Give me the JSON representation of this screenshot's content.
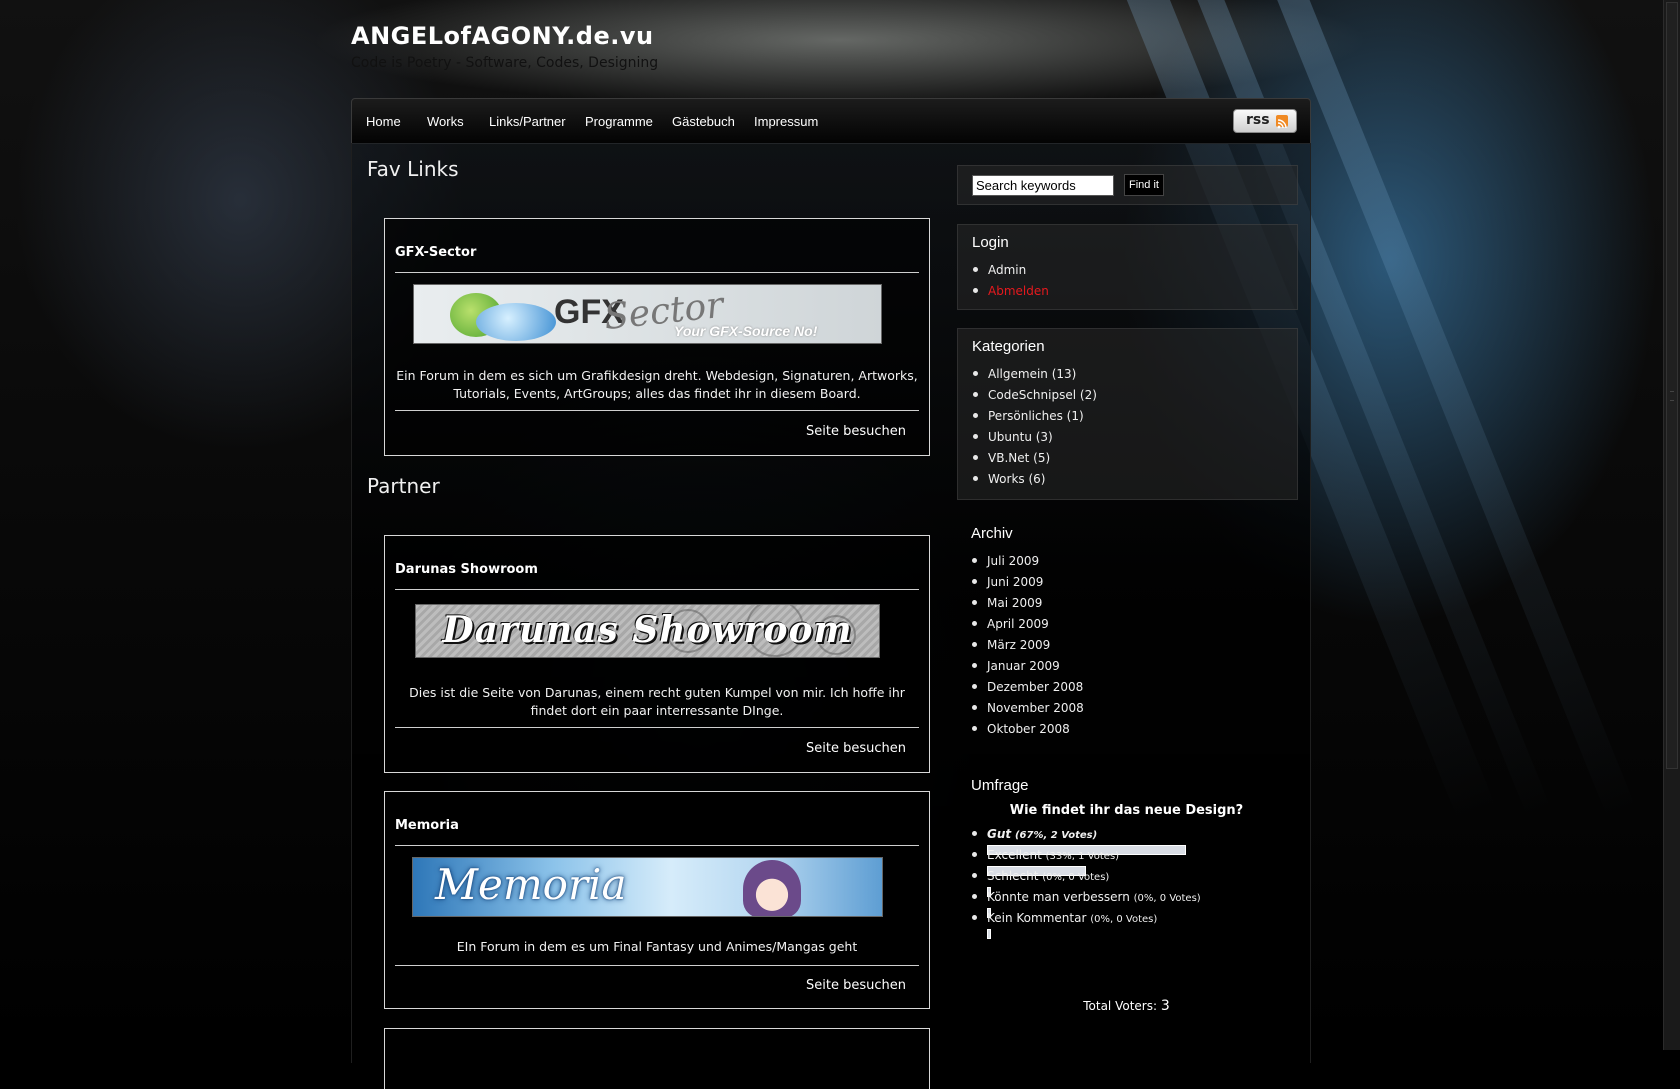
{
  "site": {
    "title": "ANGELofAGONY.de.vu",
    "tagline": "Code is Poetry - Software, Codes, Designing"
  },
  "nav": {
    "items": [
      "Home",
      "Works",
      "Links/Partner",
      "Programme",
      "Gästebuch",
      "Impressum"
    ],
    "rss_label": "rss"
  },
  "main": {
    "fav_title": "Fav Links",
    "partner_title": "Partner",
    "cards": [
      {
        "title": "GFX-Sector",
        "banner_text": "GFX",
        "banner_text2": "Sector",
        "banner_slogan": "Your GFX-Source No!",
        "description": "Ein Forum in dem es sich um Grafikdesign dreht. Webdesign, Signaturen, Artworks, Tutorials, Events, ArtGroups; alles das findet ihr in diesem Board.",
        "link": "Seite besuchen"
      },
      {
        "title": "Darunas Showroom",
        "banner_text": "Darunas Showroom",
        "description": "Dies ist die Seite von Darunas, einem recht guten Kumpel von mir. Ich hoffe ihr findet dort ein paar interressante DInge.",
        "link": "Seite besuchen"
      },
      {
        "title": "Memoria",
        "banner_text": "Memoria",
        "description": "EIn Forum in dem es um Final Fantasy und Animes/Mangas geht",
        "link": "Seite besuchen"
      }
    ]
  },
  "sidebar": {
    "search": {
      "placeholder": "Search keywords",
      "button": "Find it"
    },
    "login": {
      "title": "Login",
      "items": [
        "Admin",
        "Abmelden"
      ]
    },
    "categories": {
      "title": "Kategorien",
      "items": [
        "Allgemein (13)",
        "CodeSchnipsel (2)",
        "Persönliches (1)",
        "Ubuntu (3)",
        "VB.Net (5)",
        "Works (6)"
      ]
    },
    "archive": {
      "title": "Archiv",
      "items": [
        "Juli 2009",
        "Juni 2009",
        "Mai 2009",
        "April 2009",
        "März 2009",
        "Januar 2009",
        "Dezember 2008",
        "November 2008",
        "Oktober 2008"
      ]
    },
    "poll": {
      "title": "Umfrage",
      "question": "Wie findet ihr das neue Design?",
      "options": [
        {
          "label": "Gut",
          "stats": "(67%, 2 Votes)",
          "percent": 67
        },
        {
          "label": "Excellent",
          "stats": "(33%, 1 Votes)",
          "percent": 33
        },
        {
          "label": "Schlecht",
          "stats": "(0%, 0 Votes)",
          "percent": 0
        },
        {
          "label": "Könnte man verbessern",
          "stats": "(0%, 0 Votes)",
          "percent": 0
        },
        {
          "label": "Kein Kommentar",
          "stats": "(0%, 0 Votes)",
          "percent": 0
        }
      ],
      "total_label": "Total Voters:",
      "total_value": "3"
    }
  },
  "colors": {
    "logout_link": "#e6191e",
    "poll_bar": "#d9dde5"
  }
}
